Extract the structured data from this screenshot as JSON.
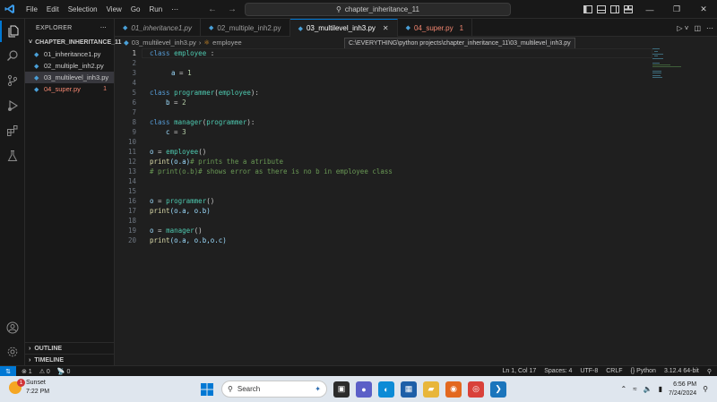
{
  "menu": [
    "File",
    "Edit",
    "Selection",
    "View",
    "Go",
    "Run",
    "⋯"
  ],
  "search_text": "chapter_inheritance_11",
  "sidebar": {
    "header": "EXPLORER",
    "more": "⋯",
    "folder": "CHAPTER_INHERITANCE_11",
    "files": [
      {
        "name": "01_inheritance1.py",
        "selected": false,
        "error": false
      },
      {
        "name": "02_multiple_inh2.py",
        "selected": false,
        "error": false
      },
      {
        "name": "03_multilevel_inh3.py",
        "selected": true,
        "error": false
      },
      {
        "name": "04_super.py",
        "selected": false,
        "error": true,
        "count": "1"
      }
    ],
    "outline": "OUTLINE",
    "timeline": "TIMELINE"
  },
  "tabs": [
    {
      "label": "01_inheritance1.py"
    },
    {
      "label": "02_multiple_inh2.py"
    },
    {
      "label": "03_multilevel_inh3.py",
      "close": "✕"
    },
    {
      "label": "04_super.py",
      "count": "1"
    }
  ],
  "breadcrumb": {
    "file": "03_multilevel_inh3.py",
    "symbol": "employee"
  },
  "tooltip": "C:\\EVERYTHING\\python projects\\chapter_inheritance_11\\03_multilevel_inh3.py",
  "line_numbers": [
    "1",
    "2",
    "3",
    "4",
    "5",
    "6",
    "7",
    "8",
    "9",
    "10",
    "11",
    "12",
    "13",
    "14",
    "15",
    "16",
    "17",
    "18",
    "19",
    "20"
  ],
  "code": {
    "l1_kw": "class",
    "l1_cls": "employee",
    "l1_rest": " :",
    "l3_var": "a",
    "l3_op": " = ",
    "l3_num": "1",
    "l5_kw": "class",
    "l5_cls": "programmer",
    "l5_p1": "(",
    "l5_base": "employee",
    "l5_p2": "):",
    "l6_var": "b",
    "l6_op": " = ",
    "l6_num": "2",
    "l8_kw": "class",
    "l8_cls": "manager",
    "l8_p1": "(",
    "l8_base": "programmer",
    "l8_p2": "):",
    "l9_var": "c",
    "l9_op": " = ",
    "l9_num": "3",
    "l11_var": "o",
    "l11_op": " = ",
    "l11_cls": "employee",
    "l11_rest": "()",
    "l12_fn": "print",
    "l12_args": "(o.a)",
    "l12_cmt": "# prints the a atribute",
    "l13_cmt": "# print(o.b)# shows error as there is no b in employee class",
    "l16_var": "o",
    "l16_op": " = ",
    "l16_cls": "programmer",
    "l16_rest": "()",
    "l17_fn": "print",
    "l17_args": "(o.a, o.b)",
    "l19_var": "o",
    "l19_op": " = ",
    "l19_cls": "manager",
    "l19_rest": "()",
    "l20_fn": "print",
    "l20_args": "(o.a, o.b,o.c)"
  },
  "status": {
    "errors": "⊗ 1",
    "warnings": "⚠ 0",
    "ports": "📡 0",
    "position": "Ln 1, Col 17",
    "spaces": "Spaces: 4",
    "encoding": "UTF-8",
    "eol": "CRLF",
    "language": "{} Python",
    "interpreter": "3.12.4 64-bit"
  },
  "taskbar": {
    "weather_name": "Sunset",
    "weather_time": "7:22 PM",
    "weather_badge": "1",
    "search_placeholder": "Search",
    "time": "6:56 PM",
    "date": "7/24/2024"
  },
  "colors": {
    "accent": "#0078d4",
    "keyword": "#569cd6",
    "class": "#4ec9b0",
    "function": "#dcdcaa",
    "number": "#b5cea8",
    "variable": "#9cdcfe",
    "comment": "#6a9955",
    "error": "#f48771"
  }
}
